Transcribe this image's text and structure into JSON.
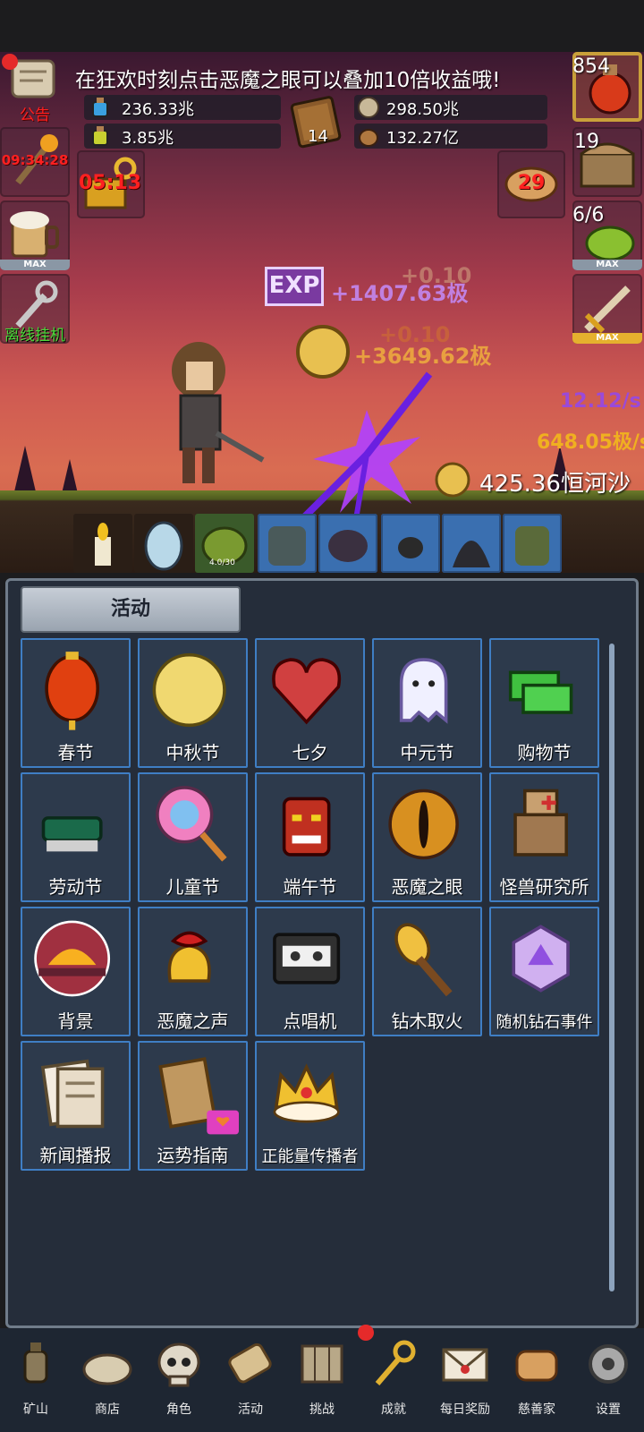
{
  "notice": {
    "label": "公告",
    "message": "在狂欢时刻点击恶魔之眼可以叠加10倍收益哦!"
  },
  "resources": {
    "blue_potion": "236.33兆",
    "green_potion": "3.85兆",
    "book_count": "14",
    "silver_coin": "298.50兆",
    "seed": "132.27亿"
  },
  "left_buttons": {
    "torch_timer": "09:34:28",
    "chest_timer": "05:13",
    "beer_max": "MAX",
    "offline_label": "离线挂机"
  },
  "right_buttons": {
    "potion_count": "854",
    "chest_count": "19",
    "slime_count": "6/6",
    "slime_max": "MAX",
    "sword_max": "MAX",
    "bread_count": "29"
  },
  "battle": {
    "exp_badge": "EXP",
    "float1": "+1407.63极",
    "float1_b": "+0.10",
    "float2": "+3649.62极",
    "float2_b": "+0.10",
    "rate1": "12.12/s",
    "rate2": "648.05极/s",
    "total_gold": "425.36恒河沙",
    "slime_level": "4.0/30"
  },
  "panel": {
    "title": "活动",
    "items": [
      {
        "label": "春节",
        "icon": "lantern-icon"
      },
      {
        "label": "中秋节",
        "icon": "moon-icon"
      },
      {
        "label": "七夕",
        "icon": "heart-icon"
      },
      {
        "label": "中元节",
        "icon": "ghost-icon"
      },
      {
        "label": "购物节",
        "icon": "money-icon"
      },
      {
        "label": "劳动节",
        "icon": "brush-icon"
      },
      {
        "label": "儿童节",
        "icon": "lollipop-icon"
      },
      {
        "label": "端午节",
        "icon": "dragon-mask-icon"
      },
      {
        "label": "恶魔之眼",
        "icon": "demon-eye-icon"
      },
      {
        "label": "怪兽研究所",
        "icon": "lab-crate-icon"
      },
      {
        "label": "背景",
        "icon": "sunset-icon"
      },
      {
        "label": "恶魔之声",
        "icon": "bell-icon"
      },
      {
        "label": "点唱机",
        "icon": "cassette-icon"
      },
      {
        "label": "钻木取火",
        "icon": "torch-icon"
      },
      {
        "label": "随机钻石事件",
        "icon": "diamond-icon"
      },
      {
        "label": "新闻播报",
        "icon": "newspaper-icon"
      },
      {
        "label": "运势指南",
        "icon": "fortune-scroll-icon"
      },
      {
        "label": "正能量传播者",
        "icon": "crown-icon"
      }
    ]
  },
  "nav": [
    {
      "label": "矿山",
      "icon": "lantern-nav-icon"
    },
    {
      "label": "商店",
      "icon": "shop-shell-icon"
    },
    {
      "label": "角色",
      "icon": "skull-icon"
    },
    {
      "label": "活动",
      "icon": "scroll-icon"
    },
    {
      "label": "挑战",
      "icon": "map-icon"
    },
    {
      "label": "成就",
      "icon": "key-icon"
    },
    {
      "label": "每日奖励",
      "icon": "envelope-icon"
    },
    {
      "label": "慈善家",
      "icon": "bread-icon"
    },
    {
      "label": "设置",
      "icon": "gear-icon"
    }
  ]
}
